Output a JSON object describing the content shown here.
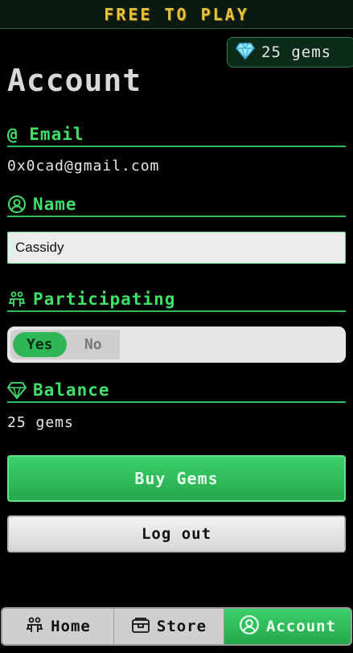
{
  "header": {
    "title": "FREE TO PLAY"
  },
  "gems_badge": {
    "icon": "gem-icon",
    "text": "25 gems"
  },
  "page": {
    "title": "Account"
  },
  "email_section": {
    "icon": "at-icon",
    "label": "@ Email",
    "value": "0x0cad@gmail.com"
  },
  "name_section": {
    "icon": "user-circle-icon",
    "label": "Name",
    "input_value": "Cassidy"
  },
  "participating_section": {
    "icon": "participants-icon",
    "label": "Participating",
    "options": [
      "Yes",
      "No"
    ],
    "selected": "Yes"
  },
  "balance_section": {
    "icon": "gem-icon",
    "label": "Balance",
    "value": "25 gems"
  },
  "buttons": {
    "buy": "Buy Gems",
    "logout": "Log out"
  },
  "nav": {
    "items": [
      {
        "label": "Home",
        "icon": "participants-icon"
      },
      {
        "label": "Store",
        "icon": "chest-icon"
      },
      {
        "label": "Account",
        "icon": "user-circle-icon",
        "active": true
      }
    ]
  },
  "colors": {
    "accent": "#2fb757",
    "heading": "#3ee06a",
    "brand_title": "#e6c23a"
  }
}
